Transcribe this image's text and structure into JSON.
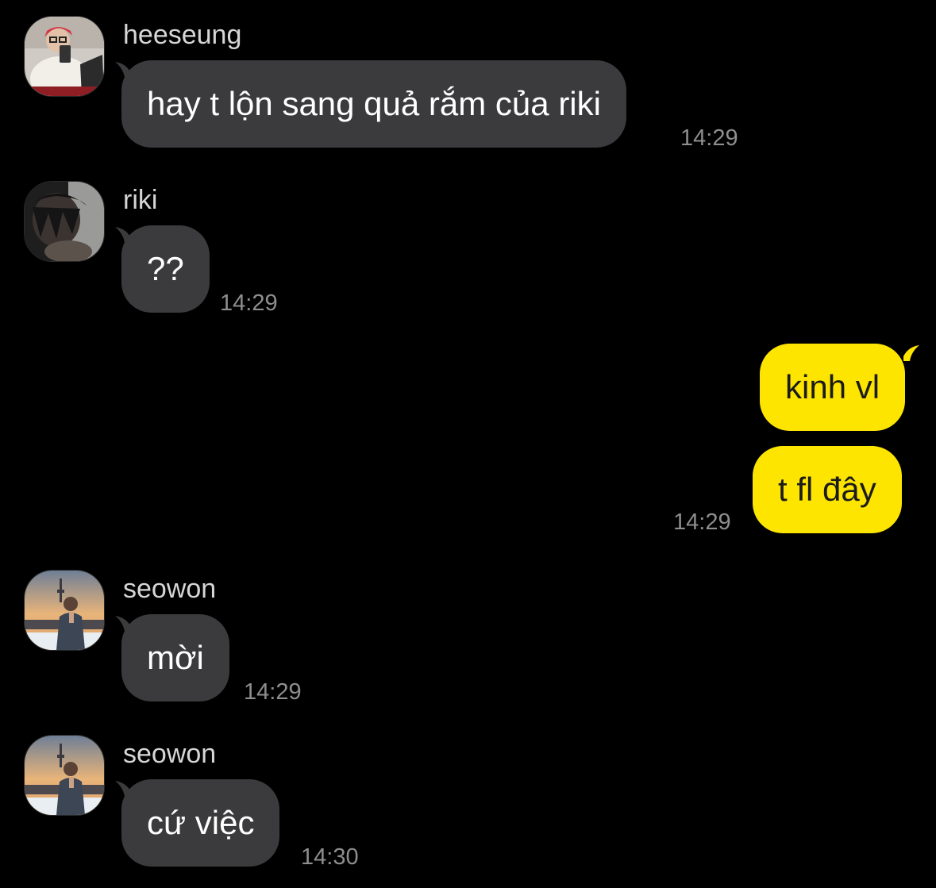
{
  "messages": [
    {
      "sender": "heeseung",
      "text": "hay t lộn sang quả rắm của riki",
      "time": "14:29"
    },
    {
      "sender": "riki",
      "text": "??",
      "time": "14:29"
    },
    {
      "text": "kinh vl"
    },
    {
      "text": "t fl đây",
      "time": "14:29"
    },
    {
      "sender": "seowon",
      "text": "mời",
      "time": "14:29"
    },
    {
      "sender": "seowon",
      "text": "cứ việc",
      "time": "14:30"
    }
  ],
  "colors": {
    "background": "#000000",
    "incoming_bubble": "#3b3b3d",
    "outgoing_bubble": "#fee500",
    "timestamp": "#8e8e8e",
    "sender_name": "#d6d6d6"
  }
}
